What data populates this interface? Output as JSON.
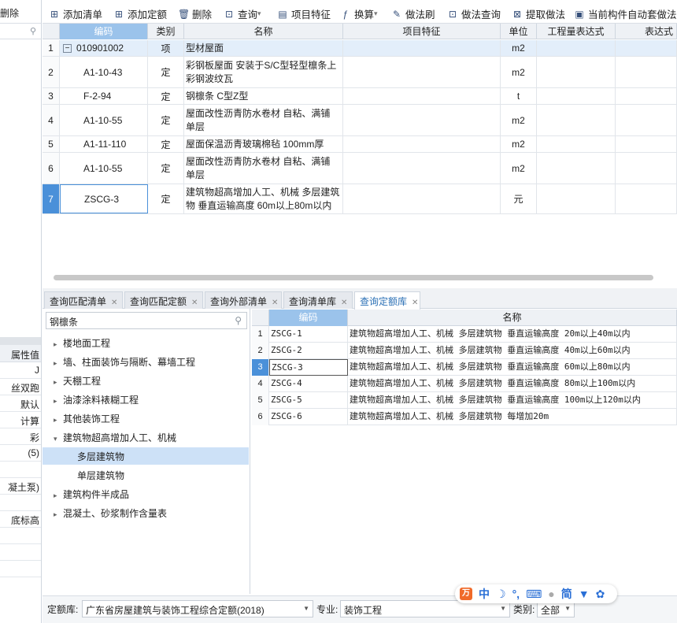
{
  "left_panel": {
    "top_text": "删除",
    "property_header": "属性值",
    "rows": [
      "J",
      "丝双跑",
      "默认",
      "计算",
      "彩",
      "(5)",
      "",
      "凝土泵)",
      "",
      "底标高",
      "",
      "",
      ""
    ]
  },
  "toolbar": {
    "items": [
      {
        "icon": "add-list-icon",
        "label": "添加清单"
      },
      {
        "icon": "add-quota-icon",
        "label": "添加定额"
      },
      {
        "icon": "delete-icon",
        "label": "删除"
      },
      {
        "icon": "query-icon",
        "label": "查询"
      },
      {
        "icon": "item-feature-icon",
        "label": "项目特征"
      },
      {
        "icon": "fx-icon",
        "label": "换算"
      },
      {
        "icon": "brush-icon",
        "label": "做法刷"
      },
      {
        "icon": "method-query-icon",
        "label": "做法查询"
      },
      {
        "icon": "extract-icon",
        "label": "提取做法"
      },
      {
        "icon": "auto-apply-icon",
        "label": "当前构件自动套做法"
      }
    ]
  },
  "main_grid": {
    "headers": {
      "code": "编码",
      "type": "类别",
      "name": "名称",
      "feature": "项目特征",
      "unit": "单位",
      "expr": "工程量表达式",
      "expr2": "表达式"
    },
    "rows": [
      {
        "num": "1",
        "code": "010901002",
        "type": "项",
        "name": "型材屋面",
        "unit": "m2"
      },
      {
        "num": "2",
        "code": "A1-10-43",
        "type": "定",
        "name": "彩钢板屋面 安装于S/C型轻型檩条上 彩钢波纹瓦",
        "unit": "m2"
      },
      {
        "num": "3",
        "code": "F-2-94",
        "type": "定",
        "name": "钢檩条 C型Z型",
        "unit": "t"
      },
      {
        "num": "4",
        "code": "A1-10-55",
        "type": "定",
        "name": "屋面改性沥青防水卷材 自粘、满铺 单层",
        "unit": "m2"
      },
      {
        "num": "5",
        "code": "A1-11-110",
        "type": "定",
        "name": "屋面保温沥青玻璃棉毡 100mm厚",
        "unit": "m2"
      },
      {
        "num": "6",
        "code": "A1-10-55",
        "type": "定",
        "name": "屋面改性沥青防水卷材 自粘、满铺 单层",
        "unit": "m2"
      },
      {
        "num": "7",
        "code": "ZSCG-3",
        "type": "定",
        "name": "建筑物超高增加人工、机械 多层建筑物 垂直运输高度 60m以上80m以内",
        "unit": "元"
      }
    ]
  },
  "tabs": [
    "查询匹配清单",
    "查询匹配定额",
    "查询外部清单",
    "查询清单库",
    "查询定额库"
  ],
  "tree": {
    "search_value": "钢檩条",
    "items": [
      {
        "label": "楼地面工程",
        "arrow": "▸"
      },
      {
        "label": "墙、柱面装饰与隔断、幕墙工程",
        "arrow": "▸"
      },
      {
        "label": "天棚工程",
        "arrow": "▸"
      },
      {
        "label": "油漆涂料裱糊工程",
        "arrow": "▸"
      },
      {
        "label": "其他装饰工程",
        "arrow": "▸"
      },
      {
        "label": "建筑物超高增加人工、机械",
        "arrow": "▾"
      },
      {
        "label": "多层建筑物",
        "arrow": ""
      },
      {
        "label": "单层建筑物",
        "arrow": ""
      },
      {
        "label": "建筑构件半成品",
        "arrow": "▸"
      },
      {
        "label": "混凝土、砂浆制作含量表",
        "arrow": "▸"
      }
    ]
  },
  "quota_grid": {
    "headers": {
      "code": "编码",
      "name": "名称"
    },
    "rows": [
      {
        "num": "1",
        "code": "ZSCG-1",
        "name": "建筑物超高增加人工、机械 多层建筑物 垂直运输高度 20m以上40m以内"
      },
      {
        "num": "2",
        "code": "ZSCG-2",
        "name": "建筑物超高增加人工、机械 多层建筑物 垂直运输高度 40m以上60m以内"
      },
      {
        "num": "3",
        "code": "ZSCG-3",
        "name": "建筑物超高增加人工、机械 多层建筑物 垂直运输高度 60m以上80m以内"
      },
      {
        "num": "4",
        "code": "ZSCG-4",
        "name": "建筑物超高增加人工、机械 多层建筑物 垂直运输高度 80m以上100m以内"
      },
      {
        "num": "5",
        "code": "ZSCG-5",
        "name": "建筑物超高增加人工、机械 多层建筑物 垂直运输高度 100m以上120m以内"
      },
      {
        "num": "6",
        "code": "ZSCG-6",
        "name": "建筑物超高增加人工、机械 多层建筑物 每增加20m"
      }
    ]
  },
  "footer": {
    "quota_lib_label": "定额库:",
    "quota_lib_value": "广东省房屋建筑与装饰工程综合定额(2018)",
    "specialty_label": "专业:",
    "specialty_value": "装饰工程",
    "category_label": "类别:",
    "category_value": "全部"
  },
  "ime": {
    "chinese": "中",
    "simplified": "简"
  }
}
